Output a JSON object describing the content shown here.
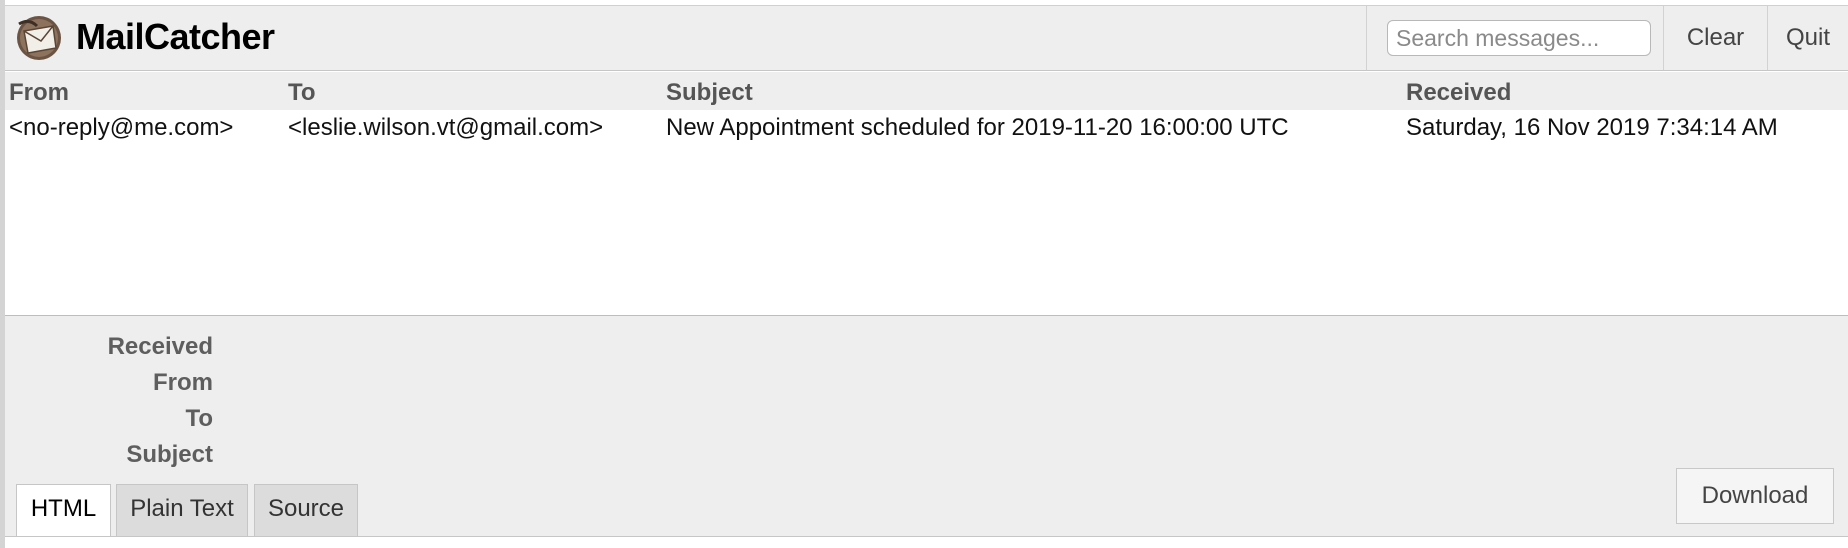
{
  "app": {
    "title": "MailCatcher",
    "logo_icon": "mailcatcher-logo-icon"
  },
  "header": {
    "search_placeholder": "Search messages...",
    "clear_label": "Clear",
    "quit_label": "Quit"
  },
  "message_list": {
    "columns": [
      "From",
      "To",
      "Subject",
      "Received"
    ],
    "rows": [
      {
        "from": "<no-reply@me.com>",
        "to": "<leslie.wilson.vt@gmail.com>",
        "subject": "New Appointment scheduled for 2019-11-20 16:00:00 UTC",
        "received": "Saturday, 16 Nov 2019 7:34:14 AM"
      }
    ]
  },
  "details": {
    "labels": [
      "Received",
      "From",
      "To",
      "Subject"
    ],
    "tabs": [
      "HTML",
      "Plain Text",
      "Source"
    ],
    "active_tab": "HTML",
    "download_label": "Download"
  },
  "colors": {
    "header_bg": "#eeeeee",
    "list_bg": "#ffffff",
    "label_gray": "#5e5e5e"
  }
}
